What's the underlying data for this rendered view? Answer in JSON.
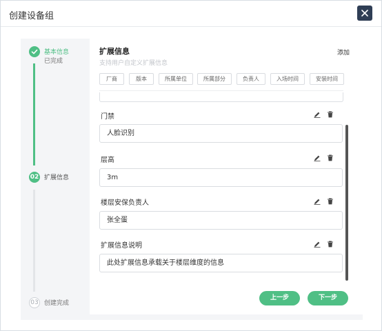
{
  "dialog": {
    "title": "创建设备组"
  },
  "steps": [
    {
      "index": "",
      "title": "基本信息",
      "subtitle": "已完成"
    },
    {
      "index": "02",
      "title": "扩展信息"
    },
    {
      "index": "03",
      "title": "创建完成"
    }
  ],
  "extension": {
    "title": "扩展信息",
    "subtitle": "支持用户自定义扩展信息",
    "add_label": "添加",
    "tags": [
      "厂商",
      "版本",
      "所属单位",
      "所属部分",
      "负责人",
      "入场时间",
      "安装时间"
    ]
  },
  "fields": [
    {
      "label": "门禁",
      "value": "人脸识别"
    },
    {
      "label": "层高",
      "value": "3m"
    },
    {
      "label": "楼层安保负责人",
      "value": "张全蛋"
    },
    {
      "label": "扩展信息说明",
      "value": "此处扩展信息承载关于楼层维度的信息"
    }
  ],
  "buttons": {
    "prev": "上一步",
    "next": "下一步"
  },
  "colors": {
    "accent": "#4fbf85",
    "header_button": "#2f3e55"
  }
}
